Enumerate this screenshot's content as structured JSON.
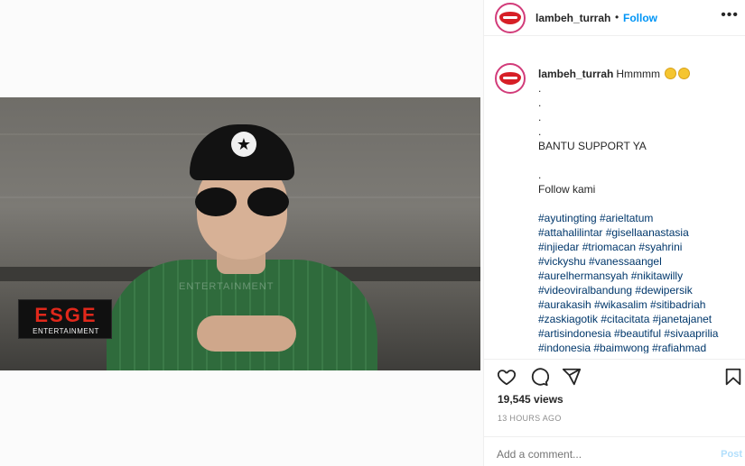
{
  "post": {
    "author": "lambeh_turrah",
    "follow_label": "Follow",
    "dot": "•",
    "more_icon": "more-options-icon",
    "accent_color": "#0095f6"
  },
  "video": {
    "logo_top": "ESGE",
    "logo_bottom": "ENTERTAINMENT",
    "watermark": "ENTERTAINMENT"
  },
  "caption": {
    "author": "lambeh_turrah",
    "text": "Hmmmm",
    "emojis": [
      "thinking-face-icon",
      "thinking-face-icon"
    ],
    "dots": [
      ".",
      ".",
      ".",
      "."
    ],
    "support": "BANTU SUPPORT YA",
    "dot_after": ".",
    "follow_line": "Follow kami",
    "hashtag_lines": [
      "#ayutingting #arieltatum",
      "#attahalilintar #gisellaanastasia",
      "#injiedar #triomacan #syahrini",
      "#vickyshu #vanessaangel",
      "#aurelhermansyah #nikitawilly",
      "#videoviralbandung #dewipersik",
      "#aurakasih #wikasalim #sitibadriah",
      "#zaskiagotik #citacitata #janetajanet",
      "#artisindonesia #beautiful #sivaaprilia",
      "#indonesia #baimwong #rafiahmad"
    ]
  },
  "stats": {
    "views": "19,545 views",
    "time_ago": "13 HOURS AGO"
  },
  "comment_box": {
    "placeholder": "Add a comment...",
    "post_label": "Post",
    "post_color": "#b2dffc"
  }
}
